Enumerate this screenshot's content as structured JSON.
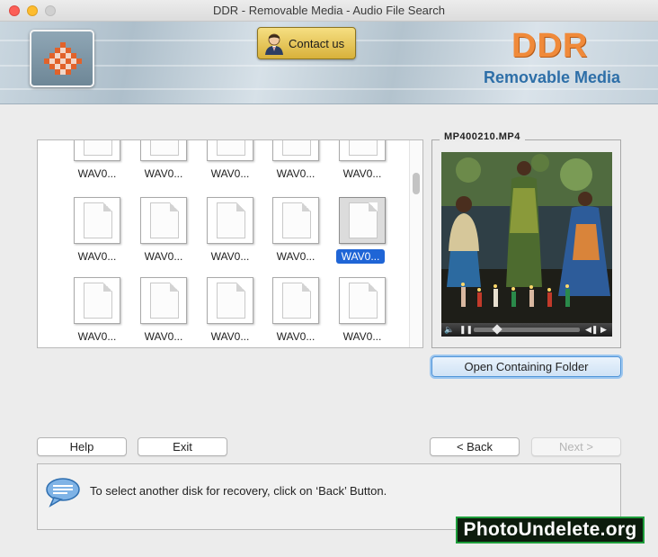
{
  "window": {
    "title": "DDR - Removable Media - Audio File Search"
  },
  "header": {
    "contact_label": "Contact us",
    "brand": "DDR",
    "brand_sub": "Removable Media",
    "brand_color": "#f08a3a",
    "sub_color": "#2e6fa8"
  },
  "files": {
    "rows": [
      [
        "WAV0...",
        "WAV0...",
        "WAV0...",
        "WAV0...",
        "WAV0..."
      ],
      [
        "WAV0...",
        "WAV0...",
        "WAV0...",
        "WAV0...",
        "WAV0..."
      ],
      [
        "WAV0...",
        "WAV0...",
        "WAV0...",
        "WAV0...",
        "WAV0..."
      ]
    ],
    "selected": {
      "row": 1,
      "col": 4
    }
  },
  "preview": {
    "filename": "MP400210.MP4",
    "open_folder_label": "Open Containing Folder"
  },
  "buttons": {
    "help": "Help",
    "exit": "Exit",
    "back": "< Back",
    "next": "Next >"
  },
  "status": {
    "message": "To select another disk for recovery, click on ‘Back’ Button."
  },
  "watermark": "PhotoUndelete.org"
}
